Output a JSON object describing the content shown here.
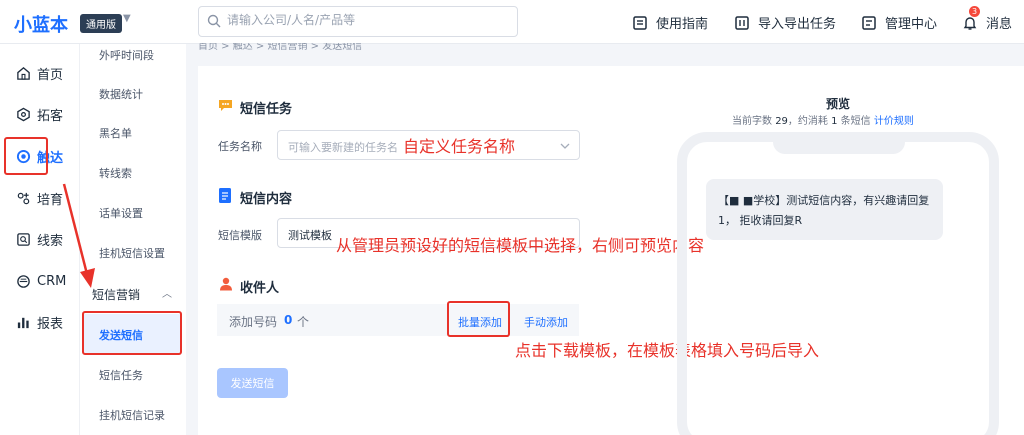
{
  "topbar": {
    "logo": "小蓝本",
    "edition": "通用版",
    "search_placeholder": "请输入公司/人名/产品等",
    "nav": [
      "使用指南",
      "导入导出任务",
      "管理中心",
      "消息"
    ],
    "message_badge": "3"
  },
  "sidebar": {
    "items": [
      "首页",
      "拓客",
      "触达",
      "培育",
      "线索",
      "CRM",
      "报表"
    ],
    "active": "触达"
  },
  "subnav": {
    "items": [
      "外呼时间段",
      "数据统计",
      "黑名单",
      "转线索",
      "话单设置",
      "挂机短信设置"
    ],
    "group": "短信营销",
    "group_items": [
      "发送短信",
      "短信任务",
      "挂机短信记录"
    ],
    "active": "发送短信"
  },
  "breadcrumb": "首页 > 触达 > 短信营销 > 发送短信",
  "form": {
    "task_section": "短信任务",
    "task_name_label": "任务名称",
    "task_name_placeholder": "可输入要新建的任务名",
    "content_section": "短信内容",
    "template_label": "短信模版",
    "template_value": "测试模板",
    "recipients_section": "收件人",
    "add_numbers_label": "添加号码",
    "number_count": "0",
    "number_unit": "个",
    "bulk_add": "批量添加",
    "manual_add": "手动添加",
    "send_button": "发送短信"
  },
  "preview": {
    "title": "预览",
    "meta_prefix": "当前字数",
    "char_count": "29",
    "meta_mid": "，约消耗",
    "sms_count": "1",
    "meta_suffix": "条短信",
    "rule_link": "计价规则",
    "message": "【■ ■学校】测试短信内容，有兴趣请回复1， 拒收请回复R"
  },
  "annotations": {
    "task_name_hint": "自定义任务名称",
    "template_hint": "从管理员预设好的短信模板中选择，右侧可预览内容",
    "bulk_hint": "点击下载模板，在模板表格填入号码后导入"
  },
  "colors": {
    "brand": "#1e6fff",
    "annotation": "#e8322a"
  }
}
